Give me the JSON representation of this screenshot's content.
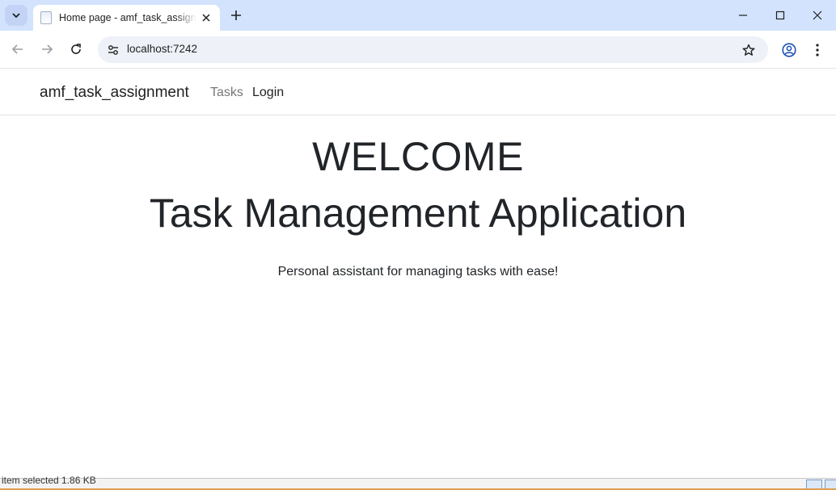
{
  "browser": {
    "tab_title": "Home page - amf_task_assignment",
    "url": "localhost:7242"
  },
  "site": {
    "brand": "amf_task_assignment",
    "nav": [
      {
        "label": "Tasks"
      },
      {
        "label": "Login"
      }
    ]
  },
  "hero": {
    "heading": "WELCOME",
    "title": "Task Management Application",
    "lead": "Personal assistant for managing tasks with ease!"
  },
  "statusbar": {
    "text": "item selected  1.86 KB"
  },
  "colors": {
    "tabstrip": "#d3e3fd",
    "omnibox": "#eef1f8",
    "text": "#212529",
    "nav_muted": "#777777"
  }
}
